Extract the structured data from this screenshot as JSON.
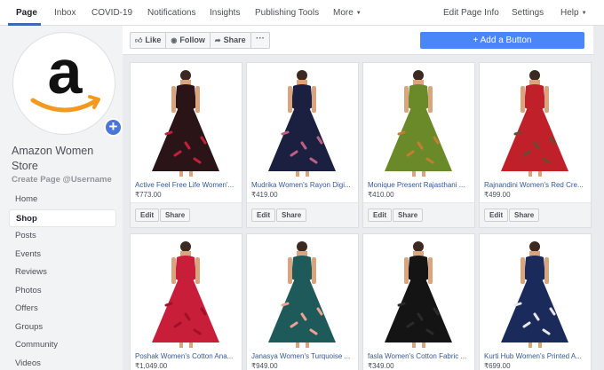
{
  "topnav": {
    "tabs": [
      "Page",
      "Inbox",
      "COVID-19",
      "Notifications",
      "Insights",
      "Publishing Tools",
      "More"
    ],
    "right": [
      "Edit Page Info",
      "Settings",
      "Help"
    ]
  },
  "page": {
    "name": "Amazon Women Store",
    "username_cta": "Create Page @Username",
    "logo_letter": "a"
  },
  "sidenav": [
    "Home",
    "Shop",
    "Posts",
    "Events",
    "Reviews",
    "Photos",
    "Offers",
    "Groups",
    "Community",
    "Videos"
  ],
  "actions": {
    "like": "Like",
    "follow": "Follow",
    "share": "Share",
    "more": "···",
    "add_button": "Add a Button"
  },
  "product_buttons": {
    "edit": "Edit",
    "share": "Share"
  },
  "products": [
    {
      "title": "Active Feel Free Life Women'...",
      "price": "₹773.00",
      "dress": "#2a1418",
      "accent": "#c4203a"
    },
    {
      "title": "Mudrika Women's Rayon Digi...",
      "price": "₹419.00",
      "dress": "#1c2040",
      "accent": "#c06080"
    },
    {
      "title": "Monique Present Rajasthani ...",
      "price": "₹410.00",
      "dress": "#6a8a2a",
      "accent": "#c08030"
    },
    {
      "title": "Rajnandini Women's Red Cre...",
      "price": "₹499.00",
      "dress": "#c0202a",
      "accent": "#6a4a30"
    },
    {
      "title": "Poshak Women's Cotton Ana...",
      "price": "₹1,049.00",
      "dress": "#c81e3a",
      "accent": "#a01028"
    },
    {
      "title": "Janasya Women's Turquoise ...",
      "price": "₹949.00",
      "dress": "#1e5a5a",
      "accent": "#f0a090"
    },
    {
      "title": "fasla Women's Cotton Fabric ...",
      "price": "₹349.00",
      "dress": "#141414",
      "accent": "#2a2a2a"
    },
    {
      "title": "Kurti Hub Women's Printed A...",
      "price": "₹699.00",
      "dress": "#1a2a5a",
      "accent": "#e8e8e8"
    }
  ],
  "colors": {
    "brand": "#4267b2",
    "cta": "#4a86f7",
    "link": "#365899",
    "logo_orange": "#f39a1e"
  }
}
